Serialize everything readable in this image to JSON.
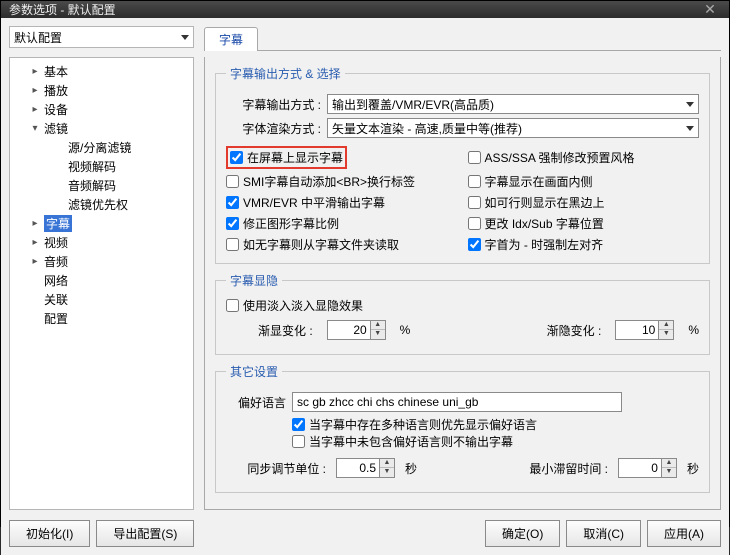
{
  "title": "参数选项 - 默认配置",
  "profile": "默认配置",
  "tab_label": "字幕",
  "tree": {
    "items": [
      {
        "label": "基本",
        "exp": "▸",
        "indent": 1
      },
      {
        "label": "播放",
        "exp": "▸",
        "indent": 1
      },
      {
        "label": "设备",
        "exp": "▸",
        "indent": 1
      },
      {
        "label": "滤镜",
        "exp": "▾",
        "indent": 1
      },
      {
        "label": "源/分离滤镜",
        "exp": "",
        "indent": 2
      },
      {
        "label": "视频解码",
        "exp": "",
        "indent": 2
      },
      {
        "label": "音频解码",
        "exp": "",
        "indent": 2
      },
      {
        "label": "滤镜优先权",
        "exp": "",
        "indent": 2
      },
      {
        "label": "字幕",
        "exp": "▸",
        "indent": 1,
        "sel": true
      },
      {
        "label": "视频",
        "exp": "▸",
        "indent": 1
      },
      {
        "label": "音频",
        "exp": "▸",
        "indent": 1
      },
      {
        "label": "网络",
        "exp": "",
        "indent": 1
      },
      {
        "label": "关联",
        "exp": "",
        "indent": 1
      },
      {
        "label": "配置",
        "exp": "",
        "indent": 1
      }
    ]
  },
  "group1": {
    "legend": "字幕输出方式 & 选择",
    "out_label": "字幕输出方式 :",
    "out_value": "输出到覆盖/VMR/EVR(高品质)",
    "render_label": "字体渲染方式 :",
    "render_value": "矢量文本渲染 - 高速,质量中等(推荐)",
    "checks": [
      {
        "label": "在屏幕上显示字幕",
        "checked": true,
        "hl": true
      },
      {
        "label": "ASS/SSA 强制修改预置风格",
        "checked": false
      },
      {
        "label": "SMI字幕自动添加<BR>换行标签",
        "checked": false
      },
      {
        "label": "字幕显示在画面内侧",
        "checked": false
      },
      {
        "label": "VMR/EVR 中平滑输出字幕",
        "checked": true
      },
      {
        "label": "如可行则显示在黑边上",
        "checked": false
      },
      {
        "label": "修正图形字幕比例",
        "checked": true
      },
      {
        "label": "更改 Idx/Sub 字幕位置",
        "checked": false
      },
      {
        "label": "如无字幕则从字幕文件夹读取",
        "checked": false
      },
      {
        "label": "字首为 - 时强制左对齐",
        "checked": true
      }
    ]
  },
  "group2": {
    "legend": "字幕显隐",
    "fade_check": "使用淡入淡入显隐效果",
    "fade_in_label": "渐显变化 :",
    "fade_in_value": "20",
    "pct": "%",
    "fade_out_label": "渐隐变化 :",
    "fade_out_value": "10"
  },
  "group3": {
    "legend": "其它设置",
    "preflang_label": "偏好语言",
    "preflang_value": "sc gb zhcc chi chs chinese uni_gb",
    "c1": "当字幕中存在多种语言则优先显示偏好语言",
    "c2": "当字幕中未包含偏好语言则不输出字幕",
    "sync_label": "同步调节单位 :",
    "sync_value": "0.5",
    "sec": "秒",
    "mindwell_label": "最小滞留时间 :",
    "mindwell_value": "0"
  },
  "buttons": {
    "init": "初始化(I)",
    "export": "导出配置(S)",
    "ok": "确定(O)",
    "cancel": "取消(C)",
    "apply": "应用(A)"
  }
}
